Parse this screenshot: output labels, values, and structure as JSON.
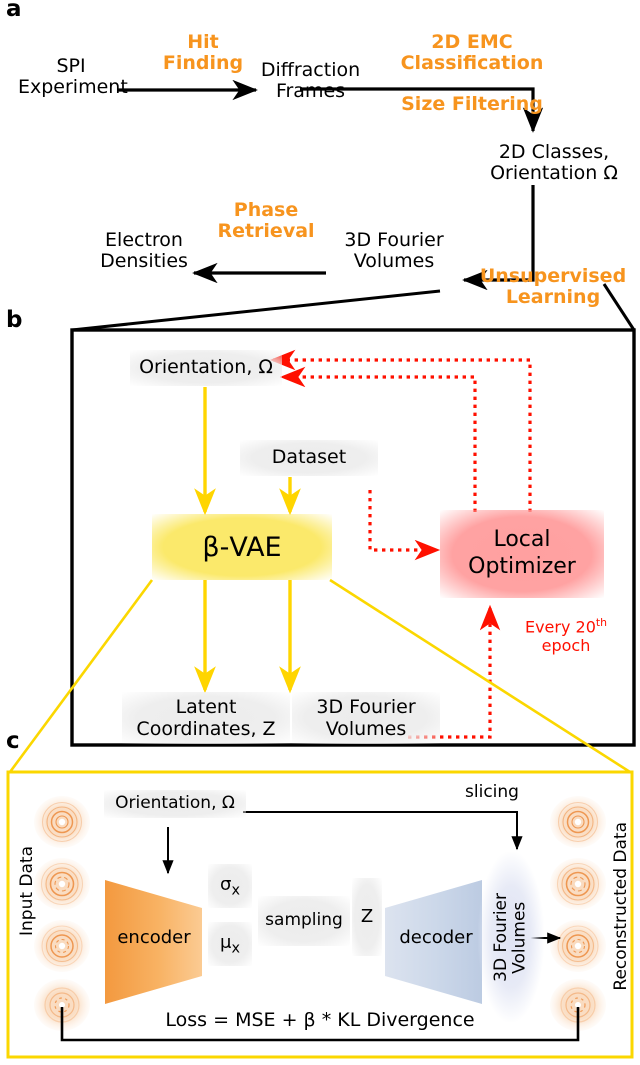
{
  "figure": {
    "panels": [
      "a",
      "b",
      "c"
    ],
    "colors": {
      "orange_accent": "#F7941E",
      "red_dashed": "#FF1000",
      "yellow_box": "#FBE96B",
      "pink_box": "#FFA0A0",
      "gray_box": "#ececec",
      "encoder_orange": "#F5A14B",
      "decoder_blue": "#CAD6E8",
      "diffraction_orange": "#F08A3C",
      "black": "#000000"
    }
  },
  "panel_a": {
    "label": "a",
    "nodes": [
      {
        "id": "spi",
        "line1": "SPI",
        "line2": "Experiment"
      },
      {
        "id": "frames",
        "line1": "Diffraction",
        "line2": "Frames"
      },
      {
        "id": "classes",
        "line1": "2D Classes,",
        "line2": "Orientation Ω"
      },
      {
        "id": "fourier",
        "line1": "3D Fourier",
        "line2": "Volumes"
      },
      {
        "id": "densities",
        "line1": "Electron",
        "line2": "Densities"
      }
    ],
    "edge_labels": [
      {
        "id": "hit-finding",
        "line1": "Hit",
        "line2": "Finding"
      },
      {
        "id": "emc",
        "line1": "2D EMC",
        "line2": "Classification"
      },
      {
        "id": "size-filtering",
        "line1": "Size Filtering",
        "line2": ""
      },
      {
        "id": "unsupervised",
        "line1": "Unsupervised",
        "line2": "Learning"
      },
      {
        "id": "phase-retrieval",
        "line1": "Phase",
        "line2": "Retrieval"
      }
    ]
  },
  "panel_b": {
    "label": "b",
    "boxes": [
      {
        "id": "orientation",
        "text": "Orientation, Ω",
        "style": "gray"
      },
      {
        "id": "dataset",
        "text": "Dataset",
        "style": "gray"
      },
      {
        "id": "bvae",
        "text": "β-VAE",
        "style": "yellow"
      },
      {
        "id": "local-optimizer",
        "line1": "Local",
        "line2": "Optimizer",
        "style": "pink"
      },
      {
        "id": "latent",
        "line1": "Latent",
        "line2": "Coordinates, Z",
        "style": "gray"
      },
      {
        "id": "fourier",
        "line1": "3D Fourier",
        "line2": "Volumes",
        "style": "gray"
      }
    ],
    "annotations": [
      {
        "id": "epoch-note",
        "line1": "Every  20",
        "sup": "th",
        "line2": "epoch"
      }
    ]
  },
  "panel_c": {
    "label": "c",
    "side_labels": {
      "left": "Input Data",
      "right": "Reconstructed Data"
    },
    "boxes": [
      {
        "id": "orientation",
        "text": "Orientation, Ω"
      },
      {
        "id": "sigma",
        "base": "σ",
        "sub": "x"
      },
      {
        "id": "mu",
        "base": "μ",
        "sub": "x"
      },
      {
        "id": "sampling",
        "text": "sampling"
      },
      {
        "id": "latent-z",
        "text": "Z"
      }
    ],
    "shapes": [
      {
        "id": "encoder",
        "text": "encoder"
      },
      {
        "id": "decoder",
        "text": "decoder"
      },
      {
        "id": "fourier-volumes",
        "line1": "3D Fourier",
        "line2": "Volumes"
      }
    ],
    "annotations": [
      {
        "id": "slicing",
        "text": "slicing"
      },
      {
        "id": "loss",
        "text": "Loss = MSE + β * KL Divergence"
      }
    ]
  }
}
